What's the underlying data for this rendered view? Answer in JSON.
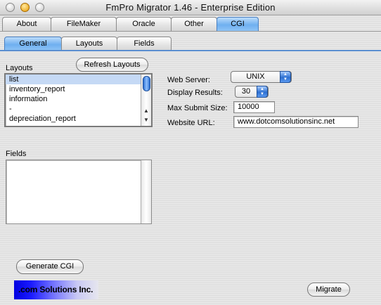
{
  "window": {
    "title": "FmPro Migrator 1.46 - Enterprise Edition"
  },
  "main_tabs": [
    {
      "label": "About"
    },
    {
      "label": "FileMaker"
    },
    {
      "label": "Oracle"
    },
    {
      "label": "Other"
    },
    {
      "label": "CGI"
    }
  ],
  "sub_tabs": [
    {
      "label": "General"
    },
    {
      "label": "Layouts"
    },
    {
      "label": "Fields"
    }
  ],
  "layouts": {
    "label": "Layouts",
    "refresh_button": "Refresh Layouts",
    "items": [
      "list",
      "inventory_report",
      "information",
      "-",
      "depreciation_report"
    ],
    "selected": "list"
  },
  "fields": {
    "label": "Fields"
  },
  "settings": {
    "web_server_label": "Web Server:",
    "web_server_value": "UNIX",
    "display_results_label": "Display Results:",
    "display_results_value": "30",
    "max_submit_label": "Max Submit Size:",
    "max_submit_value": "10000",
    "website_url_label": "Website URL:",
    "website_url_value": "www.dotcomsolutionsinc.net"
  },
  "buttons": {
    "generate_cgi": "Generate CGI",
    "migrate": "Migrate"
  },
  "logo": {
    "text": ".com Solutions Inc."
  },
  "colors": {
    "accent": "#6fb0f0",
    "selection": "#c5d9f5",
    "logo_blue": "#0000e0"
  }
}
